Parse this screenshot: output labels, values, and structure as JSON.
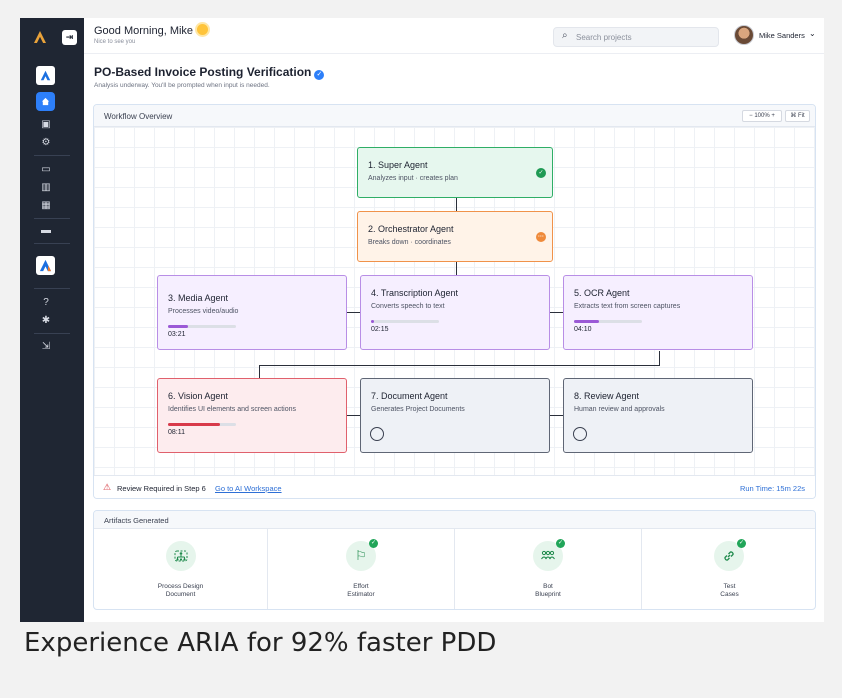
{
  "header": {
    "greeting": "Good Morning, Mike",
    "subgreeting": "Nice to see you",
    "search_placeholder": "Search projects",
    "user_name": "Mike Sanders"
  },
  "page": {
    "title": "PO-Based Invoice Posting Verification",
    "subtitle": "Analysis underway. You'll be prompted when input is needed."
  },
  "workflow": {
    "title": "Workflow Overview",
    "zoom": "− 100% +",
    "fit": "⌘ Fit",
    "nodes": [
      {
        "title": "1. Super Agent",
        "desc": "Analyzes input · creates plan",
        "status": "done"
      },
      {
        "title": "2. Orchestrator Agent",
        "desc": "Breaks down · coordinates",
        "status": "in-progress"
      },
      {
        "title": "3. Media Agent",
        "desc": "Processes video/audio",
        "progress": 0.3,
        "time": "03:21"
      },
      {
        "title": "4. Transcription Agent",
        "desc": "Converts speech to text",
        "progress": 0.05,
        "time": "02:15"
      },
      {
        "title": "5. OCR Agent",
        "desc": "Extracts text from screen captures",
        "progress": 0.37,
        "time": "04:10"
      },
      {
        "title": "6. Vision Agent",
        "desc": "Identifies UI elements and screen actions",
        "progress": 0.77,
        "time": "08:11"
      },
      {
        "title": "7. Document Agent",
        "desc": "Generates Project Documents",
        "status": "pending"
      },
      {
        "title": "8. Review Agent",
        "desc": "Human review and approvals",
        "status": "pending"
      }
    ],
    "footer": {
      "review_text": "Review Required in Step 6",
      "link_text": "Go to AI Workspace",
      "run_time": "Run Time: 15m 22s"
    }
  },
  "artifacts": {
    "title": "Artifacts Generated",
    "items": [
      {
        "label": "Process Design\nDocument",
        "icon": "process-diagram-icon",
        "checked": false
      },
      {
        "label": "Effort\nEstimator",
        "icon": "flag-icon",
        "checked": true
      },
      {
        "label": "Bot\nBlueprint",
        "icon": "users-group-icon",
        "checked": true
      },
      {
        "label": "Test\nCases",
        "icon": "link-icon",
        "checked": true
      }
    ]
  },
  "caption": "Experience ARIA for 92% faster PDD",
  "colors": {
    "sidebar": "#1f2633",
    "accent_blue": "#2d7ff9",
    "success_green": "#2fae66",
    "warning_orange": "#f0924a",
    "agent_purple": "#b88ee6",
    "alert_red": "#e0606c"
  }
}
